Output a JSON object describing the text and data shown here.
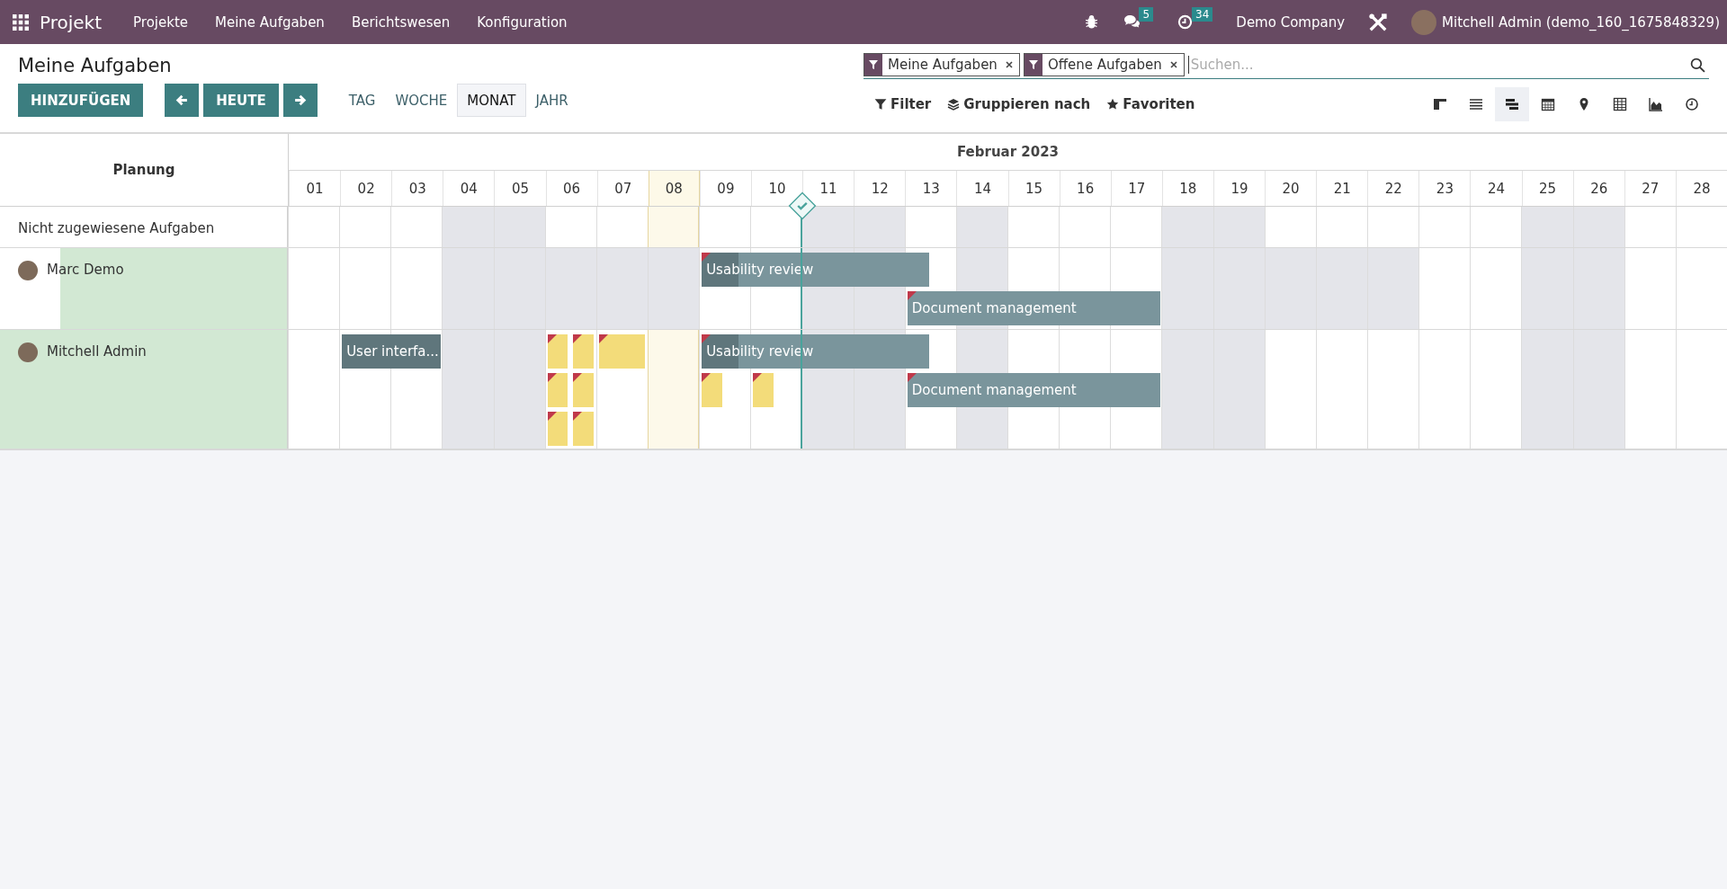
{
  "topbar": {
    "app": "Projekt",
    "menu": [
      "Projekte",
      "Meine Aufgaben",
      "Berichtswesen",
      "Konfiguration"
    ],
    "chat_count": "5",
    "activity_count": "34",
    "company": "Demo Company",
    "user": "Mitchell Admin (demo_160_1675848329)"
  },
  "control_panel": {
    "title": "Meine Aufgaben",
    "add_button": "HINZUFÜGEN",
    "today_button": "HEUTE",
    "ranges": [
      {
        "label": "TAG",
        "selected": false
      },
      {
        "label": "WOCHE",
        "selected": false
      },
      {
        "label": "MONAT",
        "selected": true
      },
      {
        "label": "JAHR",
        "selected": false
      }
    ],
    "facets": [
      {
        "label": "Meine Aufgaben"
      },
      {
        "label": "Offene Aufgaben"
      }
    ],
    "search": {
      "placeholder": "Suchen..."
    },
    "filter_menus": [
      {
        "kind": "filter",
        "label": "Filter"
      },
      {
        "kind": "group",
        "label": "Gruppieren nach"
      },
      {
        "kind": "favorite",
        "label": "Favoriten"
      }
    ],
    "views": [
      {
        "kind": "kanban",
        "selected": false
      },
      {
        "kind": "list",
        "selected": false
      },
      {
        "kind": "gantt",
        "selected": true
      },
      {
        "kind": "calendar",
        "selected": false
      },
      {
        "kind": "map",
        "selected": false
      },
      {
        "kind": "pivot",
        "selected": false
      },
      {
        "kind": "graph",
        "selected": false
      },
      {
        "kind": "activity",
        "selected": false
      }
    ]
  },
  "gantt": {
    "row_header": "Planung",
    "month": "Februar 2023",
    "days": [
      {
        "label": "01",
        "today": false,
        "milestone": false
      },
      {
        "label": "02",
        "today": false,
        "milestone": false
      },
      {
        "label": "03",
        "today": false,
        "milestone": false
      },
      {
        "label": "04",
        "today": false,
        "milestone": false
      },
      {
        "label": "05",
        "today": false,
        "milestone": false
      },
      {
        "label": "06",
        "today": false,
        "milestone": false
      },
      {
        "label": "07",
        "today": false,
        "milestone": false
      },
      {
        "label": "08",
        "today": true,
        "milestone": false
      },
      {
        "label": "09",
        "today": false,
        "milestone": false
      },
      {
        "label": "10",
        "today": false,
        "milestone": true
      },
      {
        "label": "11",
        "today": false,
        "milestone": false
      },
      {
        "label": "12",
        "today": false,
        "milestone": false
      },
      {
        "label": "13",
        "today": false,
        "milestone": false
      },
      {
        "label": "14",
        "today": false,
        "milestone": false
      },
      {
        "label": "15",
        "today": false,
        "milestone": false
      },
      {
        "label": "16",
        "today": false,
        "milestone": false
      },
      {
        "label": "17",
        "today": false,
        "milestone": false
      },
      {
        "label": "18",
        "today": false,
        "milestone": false
      },
      {
        "label": "19",
        "today": false,
        "milestone": false
      },
      {
        "label": "20",
        "today": false,
        "milestone": false
      },
      {
        "label": "21",
        "today": false,
        "milestone": false
      },
      {
        "label": "22",
        "today": false,
        "milestone": false
      },
      {
        "label": "23",
        "today": false,
        "milestone": false
      },
      {
        "label": "24",
        "today": false,
        "milestone": false
      },
      {
        "label": "25",
        "today": false,
        "milestone": false
      },
      {
        "label": "26",
        "today": false,
        "milestone": false
      },
      {
        "label": "27",
        "today": false,
        "milestone": false
      },
      {
        "label": "28",
        "today": false,
        "milestone": false
      }
    ],
    "rows": [
      {
        "kind": "unassigned",
        "name": "Nicht zugewiesene Aufgaben",
        "off": [
          false,
          false,
          false,
          true,
          true,
          false,
          false,
          false,
          false,
          false,
          true,
          true,
          false,
          true,
          false,
          false,
          false,
          true,
          true,
          false,
          false,
          false,
          false,
          false,
          true,
          true,
          false,
          false
        ],
        "lanes": []
      },
      {
        "kind": "user",
        "name": "Marc Demo",
        "level": 0.79,
        "off": [
          false,
          false,
          false,
          true,
          true,
          true,
          true,
          true,
          false,
          false,
          true,
          true,
          false,
          true,
          false,
          false,
          false,
          true,
          true,
          true,
          true,
          true,
          false,
          false,
          true,
          true,
          false,
          false
        ],
        "lanes": [
          [
            {
              "kind": "task",
              "label": "Usability review",
              "flag": true,
              "level": 0.16
            }
          ],
          [
            {
              "kind": "task",
              "label": "Document management",
              "flag": true
            }
          ]
        ]
      },
      {
        "kind": "user",
        "name": "Mitchell Admin",
        "level": 1,
        "off": [
          false,
          false,
          false,
          true,
          true,
          false,
          false,
          false,
          false,
          false,
          true,
          true,
          false,
          true,
          false,
          false,
          false,
          true,
          true,
          false,
          false,
          false,
          false,
          false,
          true,
          true,
          false,
          false
        ],
        "lanes": [
          [
            {
              "kind": "task",
              "label": "User interfa...",
              "flag": false,
              "level": 1
            },
            {
              "kind": "note",
              "flag": true
            },
            {
              "kind": "note",
              "flag": true
            },
            {
              "kind": "note",
              "flag": true
            },
            {
              "kind": "task",
              "label": "Usability review",
              "flag": true,
              "level": 0.16
            }
          ],
          [
            {
              "kind": "note",
              "flag": true
            },
            {
              "kind": "note",
              "flag": true
            },
            {
              "kind": "note",
              "flag": true
            },
            {
              "kind": "note",
              "flag": true
            },
            {
              "kind": "task",
              "label": "Document management",
              "flag": true
            }
          ],
          [
            {
              "kind": "note",
              "flag": true
            },
            {
              "kind": "note",
              "flag": true
            }
          ]
        ]
      }
    ]
  }
}
